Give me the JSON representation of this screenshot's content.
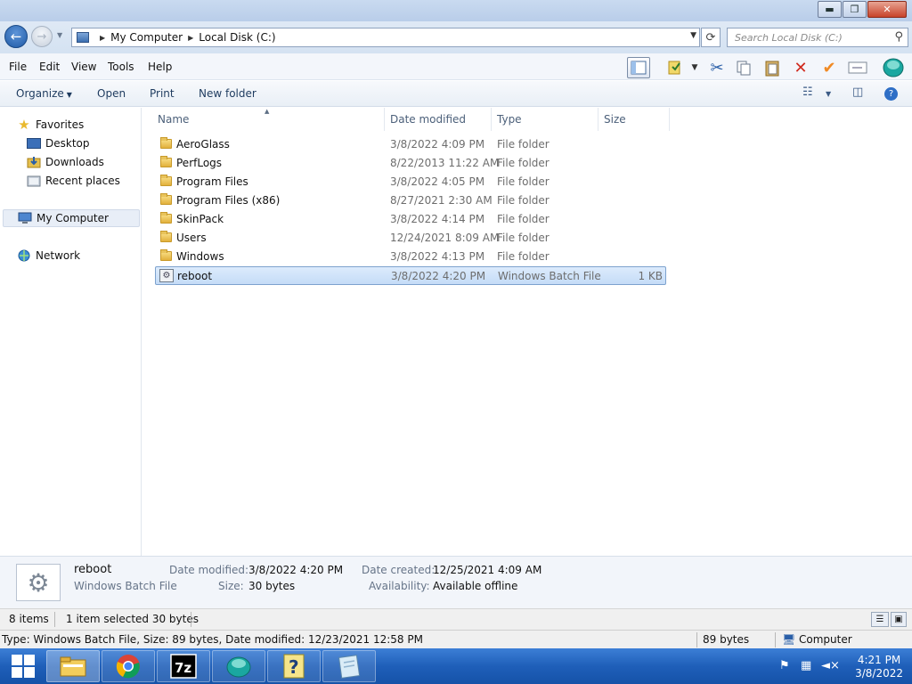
{
  "window": {
    "controls": {
      "minimize": "▬",
      "maximize": "❐",
      "close": "✕"
    }
  },
  "address": {
    "breadcrumbs": [
      "My Computer",
      "Local Disk (C:)"
    ],
    "search_placeholder": "Search Local Disk (C:)"
  },
  "menubar": {
    "items": [
      "File",
      "Edit",
      "View",
      "Tools",
      "Help"
    ]
  },
  "toolbar_icons": [
    "layout-icon",
    "properties-icon",
    "cut-icon",
    "copy-icon",
    "paste-icon",
    "delete-icon",
    "check-icon",
    "rename-icon",
    "shell-icon"
  ],
  "commandbar": {
    "organize": "Organize",
    "open": "Open",
    "print": "Print",
    "new_folder": "New folder"
  },
  "navpane": {
    "favorites": "Favorites",
    "desktop": "Desktop",
    "downloads": "Downloads",
    "recent": "Recent places",
    "computer": "My Computer",
    "network": "Network"
  },
  "columns": {
    "name": "Name",
    "date": "Date modified",
    "type": "Type",
    "size": "Size"
  },
  "files": [
    {
      "name": "AeroGlass",
      "date": "3/8/2022 4:09 PM",
      "type": "File folder",
      "size": ""
    },
    {
      "name": "PerfLogs",
      "date": "8/22/2013 11:22 AM",
      "type": "File folder",
      "size": ""
    },
    {
      "name": "Program Files",
      "date": "3/8/2022 4:05 PM",
      "type": "File folder",
      "size": ""
    },
    {
      "name": "Program Files (x86)",
      "date": "8/27/2021 2:30 AM",
      "type": "File folder",
      "size": ""
    },
    {
      "name": "SkinPack",
      "date": "3/8/2022 4:14 PM",
      "type": "File folder",
      "size": ""
    },
    {
      "name": "Users",
      "date": "12/24/2021 8:09 AM",
      "type": "File folder",
      "size": ""
    },
    {
      "name": "Windows",
      "date": "3/8/2022 4:13 PM",
      "type": "File folder",
      "size": ""
    },
    {
      "name": "reboot",
      "date": "3/8/2022 4:20 PM",
      "type": "Windows Batch File",
      "size": "1 KB"
    }
  ],
  "details": {
    "name": "reboot",
    "type": "Windows Batch File",
    "date_modified_label": "Date modified:",
    "date_modified": "3/8/2022 4:20 PM",
    "size_label": "Size:",
    "size": "30 bytes",
    "date_created_label": "Date created:",
    "date_created": "12/25/2021 4:09 AM",
    "availability_label": "Availability:",
    "availability": "Available offline"
  },
  "status": {
    "items": "8 items",
    "selected": "1 item selected  30 bytes"
  },
  "status2": {
    "info": "Type: Windows Batch File, Size: 89 bytes, Date modified: 12/23/2021 12:58 PM",
    "bytes": "89 bytes",
    "location": "Computer"
  },
  "taskbar": {
    "time": "4:21 PM",
    "date": "3/8/2022",
    "apps": [
      "file-explorer",
      "chrome",
      "7zip",
      "shell",
      "help",
      "notepad"
    ]
  }
}
